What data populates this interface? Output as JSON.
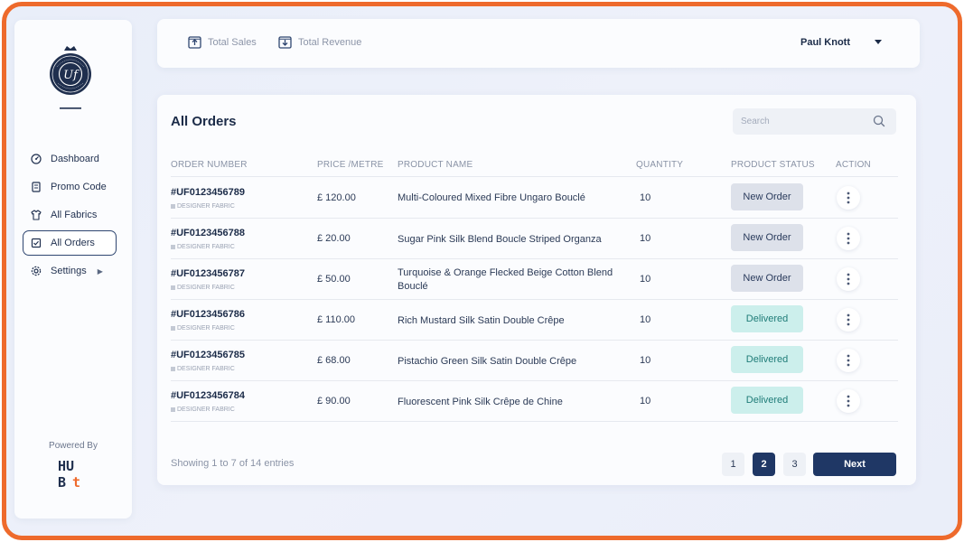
{
  "sidebar": {
    "items": [
      {
        "label": "Dashboard",
        "icon": "dashboard-gauge-icon"
      },
      {
        "label": "Promo Code",
        "icon": "promo-tag-icon"
      },
      {
        "label": "All Fabrics",
        "icon": "fabric-shirt-icon"
      },
      {
        "label": "All Orders",
        "icon": "orders-clipboard-icon",
        "active": true
      },
      {
        "label": "Settings",
        "icon": "settings-gear-icon",
        "has_submenu": true
      }
    ],
    "powered_by": "Powered By"
  },
  "topbar": {
    "total_sales": "Total Sales",
    "total_revenue": "Total Revenue",
    "user_name": "Paul Knott"
  },
  "orders": {
    "title": "All Orders",
    "search_placeholder": "Search",
    "columns": [
      "ORDER NUMBER",
      "PRICE /METRE",
      "PRODUCT NAME",
      "QUANTITY",
      "PRODUCT STATUS",
      "ACTION"
    ],
    "rows": [
      {
        "order": "#UF0123456789",
        "type": "DESIGNER FABRIC",
        "price": "£ 120.00",
        "product": "Multi-Coloured Mixed Fibre Ungaro Bouclé",
        "qty": "10",
        "status": "New Order"
      },
      {
        "order": "#UF0123456788",
        "type": "DESIGNER FABRIC",
        "price": "£ 20.00",
        "product": "Sugar Pink Silk Blend Boucle Striped Organza",
        "qty": "10",
        "status": "New Order"
      },
      {
        "order": "#UF0123456787",
        "type": "DESIGNER FABRIC",
        "price": "£ 50.00",
        "product": "Turquoise & Orange Flecked Beige Cotton Blend Bouclé",
        "qty": "10",
        "status": "New Order"
      },
      {
        "order": "#UF0123456786",
        "type": "DESIGNER FABRIC",
        "price": "£ 110.00",
        "product": "Rich Mustard Silk Satin Double Crêpe",
        "qty": "10",
        "status": "Delivered"
      },
      {
        "order": "#UF0123456785",
        "type": "DESIGNER FABRIC",
        "price": "£ 68.00",
        "product": "Pistachio Green Silk Satin Double Crêpe",
        "qty": "10",
        "status": "Delivered"
      },
      {
        "order": "#UF0123456784",
        "type": "DESIGNER FABRIC",
        "price": "£ 90.00",
        "product": "Fluorescent Pink Silk Crêpe de Chine",
        "qty": "10",
        "status": "Delivered"
      }
    ],
    "showing": "Showing 1 to 7 of 14 entries",
    "pages": [
      "1",
      "2",
      "3"
    ],
    "current_page": "2",
    "next_label": "Next"
  },
  "colors": {
    "frame_border": "#ee6a2c",
    "primary": "#1f3765",
    "new_order_bg": "#dde1ea",
    "delivered_bg": "#ccefec",
    "delivered_text": "#1f7c78"
  }
}
